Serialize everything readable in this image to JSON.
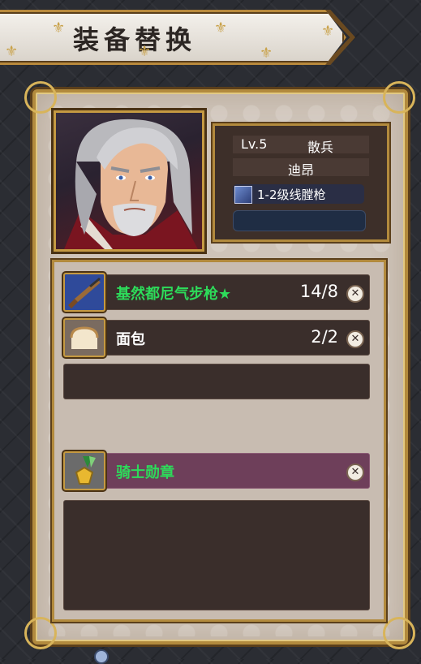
{
  "header": {
    "title": "装备替换"
  },
  "character": {
    "level": "Lv.5",
    "class": "散兵",
    "name": "迪昂",
    "weapon": "1-2级线膛枪"
  },
  "inventory": [
    {
      "name": "基然都尼气步枪★",
      "count": "14/8",
      "name_color": "#2ddb5a",
      "icon": "rifle-icon",
      "icon_bg": "#2f4a9a"
    },
    {
      "name": "面包",
      "count": "2/2",
      "name_color": "#ffffff",
      "icon": "bread-icon",
      "icon_bg": "#7a6b60"
    },
    {
      "name": "骑士勋章",
      "count": "",
      "name_color": "#2ddb5a",
      "icon": "medal-icon",
      "icon_bg": "#6b6b6b"
    }
  ],
  "colors": {
    "accent_gold": "#b28a3d",
    "highlight_row": "#6e3f5a"
  }
}
